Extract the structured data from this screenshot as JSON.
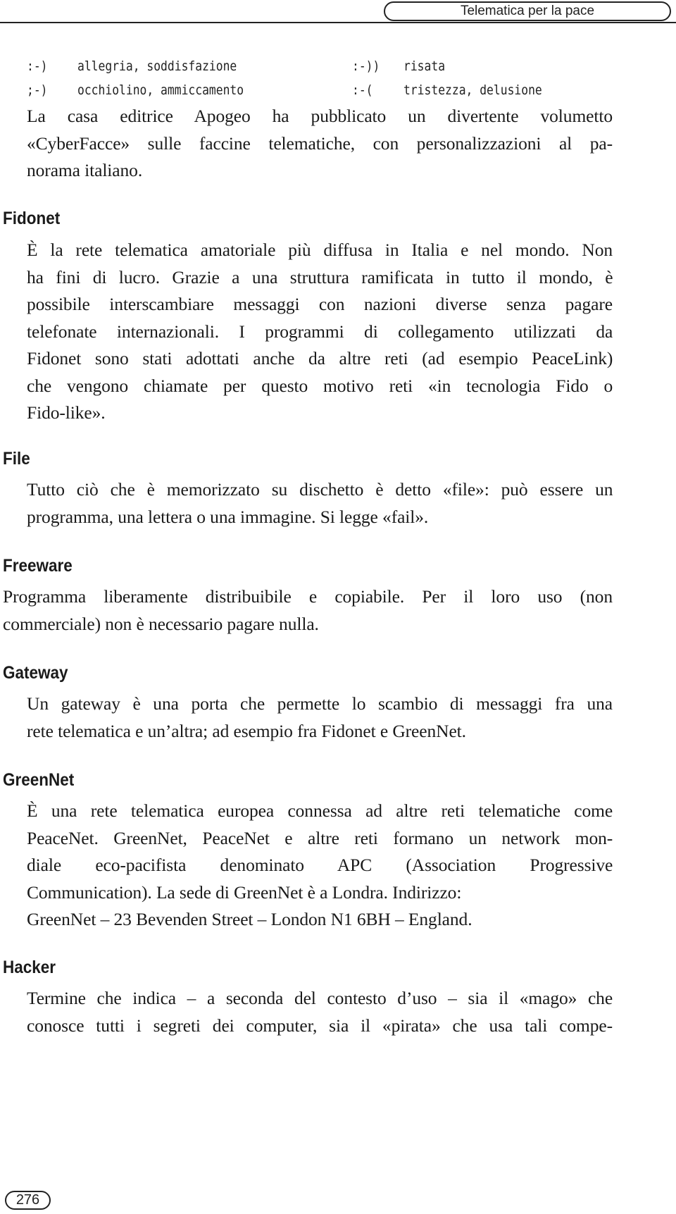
{
  "header": {
    "running_title": "Telematica per la pace"
  },
  "emoticons": [
    {
      "symbol": ":-)",
      "meaning": "allegria, soddisfazione"
    },
    {
      "symbol": ":-))",
      "meaning": "risata"
    },
    {
      "symbol": ";-)",
      "meaning": "occhiolino, ammiccamento"
    },
    {
      "symbol": ":-(",
      "meaning": "tristezza, delusione"
    }
  ],
  "intro_lines": [
    "La casa editrice Apogeo ha pubblicato un divertente volumetto",
    "«CyberFacce» sulle faccine telematiche, con personalizzazioni al pa-",
    "norama italiano."
  ],
  "entries": [
    {
      "term": "Fidonet",
      "lines": [
        "È la rete telematica amatoriale più diffusa in Italia e nel mondo. Non",
        "ha fini di lucro. Grazie a una struttura ramificata in tutto il mondo, è",
        "possibile interscambiare messaggi con nazioni diverse senza pagare",
        "telefonate internazionali. I programmi di collegamento utilizzati da",
        "Fidonet sono stati adottati anche da altre reti (ad esempio PeaceLink)",
        "che vengono chiamate per questo motivo reti «in tecnologia Fido o",
        "Fido-like»."
      ]
    },
    {
      "term": "File",
      "lines": [
        "Tutto ciò che è memorizzato su dischetto è detto «file»: può essere un",
        "programma, una lettera o una immagine. Si legge «fail»."
      ]
    },
    {
      "term": "Freeware",
      "lines": [
        "Programma liberamente distribuibile e copiabile. Per il loro uso (non",
        "commerciale) non è necessario pagare nulla."
      ]
    },
    {
      "term": "Gateway",
      "lines": [
        "Un gateway è una porta che permette lo scambio di messaggi fra una",
        "rete telematica e un’altra; ad esempio fra Fidonet e GreenNet."
      ]
    },
    {
      "term": "GreenNet",
      "lines": [
        "È una rete telematica europea connessa ad altre reti telematiche come",
        "PeaceNet. GreenNet, PeaceNet e altre reti formano un network mon-",
        "diale eco-pacifista denominato APC (Association Progressive",
        "Communication). La sede di GreenNet è a Londra. Indirizzo:",
        "GreenNet – 23 Bevenden Street – London N1 6BH – England."
      ]
    },
    {
      "term": "Hacker",
      "lines": [
        "Termine che indica – a seconda del contesto d’uso – sia il «mago» che",
        "conosce tutti i segreti dei computer, sia il «pirata» che usa tali compe-"
      ]
    }
  ],
  "footer": {
    "page_number": "276"
  }
}
